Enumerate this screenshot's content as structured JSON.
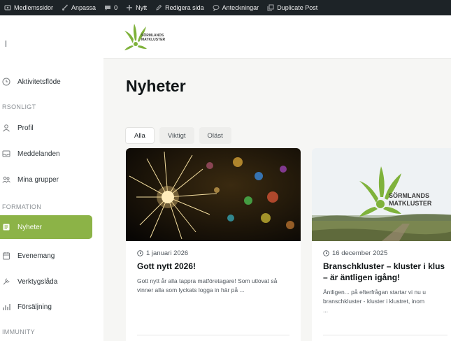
{
  "admin_bar": {
    "items": [
      {
        "label": "Medlemssidor",
        "icon": "dashboard-icon"
      },
      {
        "label": "Anpassa",
        "icon": "brush-icon"
      },
      {
        "label": "0",
        "icon": "comment-icon"
      },
      {
        "label": "Nytt",
        "icon": "plus-icon"
      },
      {
        "label": "Redigera sida",
        "icon": "pencil-icon"
      },
      {
        "label": "Anteckningar",
        "icon": "speech-bubble-icon"
      },
      {
        "label": "Duplicate Post",
        "icon": "copy-icon"
      }
    ]
  },
  "sidebar": {
    "items": [
      {
        "label": "Aktivitetsflöde",
        "icon": "activity-icon"
      },
      {
        "label": "Profil",
        "icon": "user-icon"
      },
      {
        "label": "Meddelanden",
        "icon": "inbox-icon"
      },
      {
        "label": "Mina grupper",
        "icon": "group-icon"
      },
      {
        "label": "Nyheter",
        "icon": "news-icon",
        "active": true
      },
      {
        "label": "Evenemang",
        "icon": "calendar-icon"
      },
      {
        "label": "Verktygslåda",
        "icon": "toolbox-icon"
      },
      {
        "label": "Försäljning",
        "icon": "sales-icon"
      }
    ],
    "sections": [
      "RSONLIGT",
      "FORMATION",
      "IMMUNITY"
    ]
  },
  "logo": {
    "line1": "SÖRMLANDS",
    "line2": "MATKLUSTER"
  },
  "page": {
    "title": "Nyheter"
  },
  "tabs": [
    {
      "label": "Alla",
      "active": true
    },
    {
      "label": "Viktigt"
    },
    {
      "label": "Oläst"
    }
  ],
  "cards": [
    {
      "date": "1 januari 2026",
      "title": "Gott nytt 2026!",
      "excerpt": "Gott nytt år alla tappra matföretagare! Som utlovat så vinner alla som lyckats logga in här på ..."
    },
    {
      "date": "16 december 2025",
      "title_line1": "Branschkluster – kluster i klus",
      "title_line2": "– är äntligen igång!",
      "excerpt_line1": "Äntligen... på efterfrågan startar vi nu u",
      "excerpt_line2": "branschkluster - kluster i klustret, inom",
      "excerpt_line3": "...",
      "image_logo_line1": "SÖRMLANDS",
      "image_logo_line2": "MATKLUSTER"
    }
  ],
  "colors": {
    "accent": "#8cb347",
    "adminbar": "#1d2327",
    "logo_green": "#7fb23b"
  }
}
